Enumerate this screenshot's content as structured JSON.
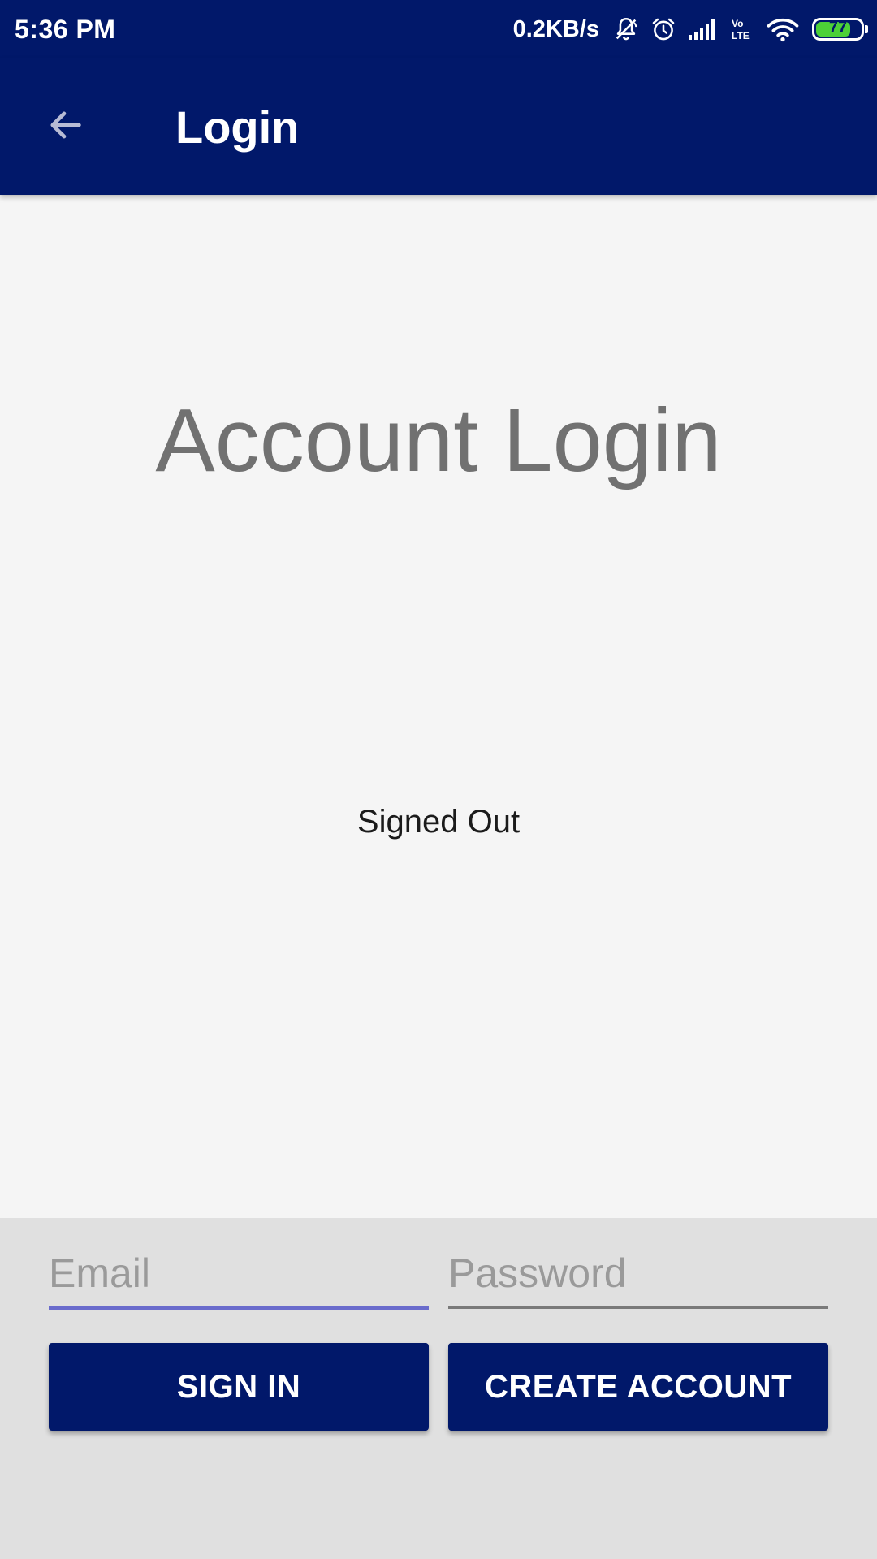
{
  "status_bar": {
    "time": "5:36 PM",
    "net_speed": "0.2KB/s",
    "battery_level": "77",
    "battery_fraction": 0.77,
    "icons": [
      "mute-bell-icon",
      "alarm-icon",
      "signal-icon",
      "volte-icon",
      "wifi-icon",
      "battery-icon"
    ]
  },
  "app_bar": {
    "title": "Login",
    "back_icon": "arrow-back-icon"
  },
  "main": {
    "headline": "Account Login",
    "auth_status": "Signed Out"
  },
  "form": {
    "email_placeholder": "Email",
    "password_placeholder": "Password",
    "sign_in_label": "SIGN IN",
    "create_account_label": "CREATE ACCOUNT"
  },
  "colors": {
    "primary": "#01186a",
    "background": "#f5f5f5",
    "panel": "#e0e0e0",
    "accent_underline": "#6a6ccc",
    "battery_fill": "#4cd137"
  }
}
